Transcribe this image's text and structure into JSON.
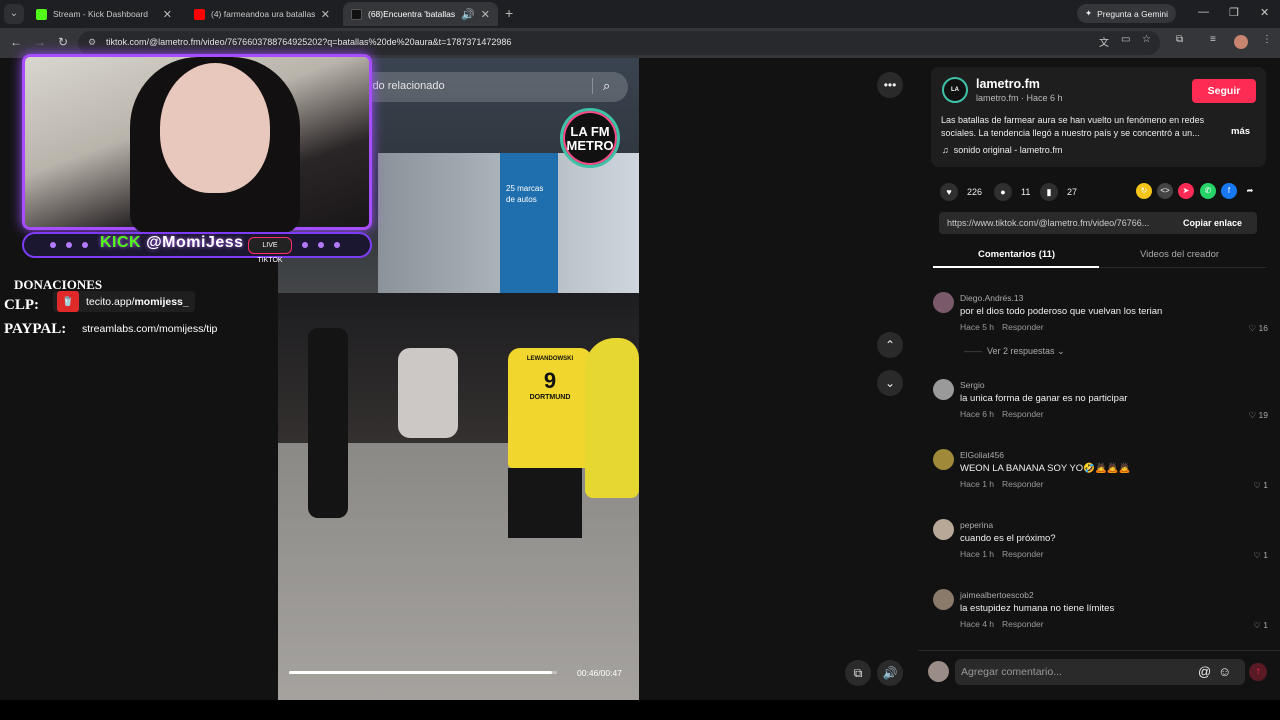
{
  "browser": {
    "tabs": [
      {
        "title": "Stream - Kick Dashboard",
        "favicon_color": "#53fc18",
        "active": false
      },
      {
        "title": "(4) farmeandoa ura batallas - Yo",
        "favicon_color": "#ff0000",
        "active": false
      },
      {
        "title": "(68)Encuentra 'batallas de a",
        "favicon_color": "#111111",
        "active": true
      }
    ],
    "gemini_label": "Pregunta a Gemini",
    "url": "tiktok.com/@lametro.fm/video/7676603788764925202?q=batallas%20de%20aura&t=1787371472986"
  },
  "overlay": {
    "kick_handle": "@MomiJess",
    "kick_word": "KICK",
    "live_badge": "LIVE TIKTOK",
    "donations_title": "DONACIONES",
    "clp_label": "CLP:",
    "paypal_label": "PAYPAL:",
    "tecito_prefix": "tecito.app/",
    "tecito_user": "momijess_",
    "streamlabs": "streamlabs.com/momijess/tip"
  },
  "video": {
    "search_placeholder": "ido relacionado",
    "logo_text": "LA FM METRO",
    "banner_text": "25 marcas de autos",
    "jersey_number": "9",
    "jersey_name": "LEWANDOWSKI",
    "jersey_team": "DORTMUND",
    "progress": 0.98,
    "timecode": "00:46/00:47"
  },
  "post": {
    "author": "lametro.fm",
    "author_sub": "lametro.fm · Hace 6 h",
    "follow_label": "Seguir",
    "description": "Las batallas de farmear aura se han vuelto un fenómeno en redes sociales. La tendencia llegó a nuestro país y se concentró a un...",
    "more_label": "más",
    "sound": "sonido original - lametro.fm",
    "likes": "226",
    "comments": "11",
    "saves": "27",
    "link": "https://www.tiktok.com/@lametro.fm/video/76766...",
    "copy_label": "Copiar enlace",
    "tab_comments": "Comentarios (11)",
    "tab_videos": "Videos del creador",
    "comment_placeholder": "Agregar comentario..."
  },
  "comments": [
    {
      "user": "Diego.Andrés.13",
      "text": "por el dios todo poderoso que vuelvan los terian",
      "time": "Hace 5 h",
      "reply": "Responder",
      "likes": "16",
      "avatar_color": "#7a5a6a"
    },
    {
      "user": "Sergio",
      "text": "la unica forma de ganar es no participar",
      "time": "Hace 6 h",
      "reply": "Responder",
      "likes": "19",
      "avatar_color": "#9a9a9a"
    },
    {
      "user": "ElGoliat456",
      "text": "WEON LA BANANA SOY YO🤣🙇🙇🙇",
      "time": "Hace 1 h",
      "reply": "Responder",
      "likes": "1",
      "avatar_color": "#a08a3a"
    },
    {
      "user": "peperina",
      "text": "cuando es el próximo?",
      "time": "Hace 1 h",
      "reply": "Responder",
      "likes": "1",
      "avatar_color": "#b8a898"
    },
    {
      "user": "jaimealbertoescob2",
      "text": "la estupidez humana no tiene límites",
      "time": "Hace 4 h",
      "reply": "Responder",
      "likes": "1",
      "avatar_color": "#8a7a6a"
    }
  ],
  "replies_label": "Ver 2 respuestas"
}
